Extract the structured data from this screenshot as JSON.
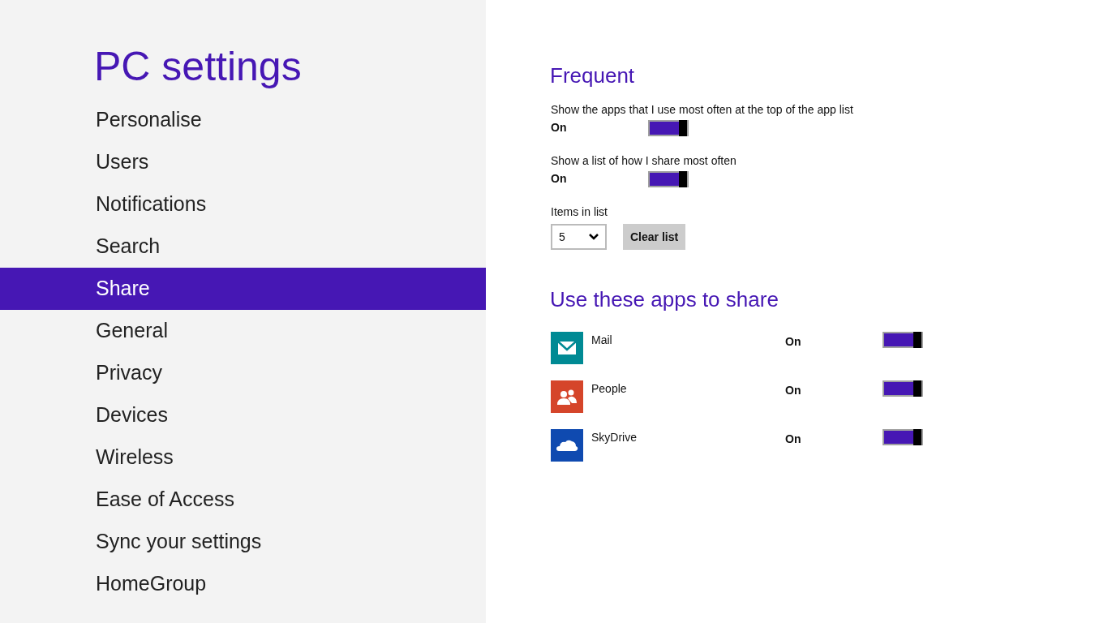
{
  "sidebar": {
    "title": "PC settings",
    "items": [
      {
        "label": "Personalise",
        "selected": false
      },
      {
        "label": "Users",
        "selected": false
      },
      {
        "label": "Notifications",
        "selected": false
      },
      {
        "label": "Search",
        "selected": false
      },
      {
        "label": "Share",
        "selected": true
      },
      {
        "label": "General",
        "selected": false
      },
      {
        "label": "Privacy",
        "selected": false
      },
      {
        "label": "Devices",
        "selected": false
      },
      {
        "label": "Wireless",
        "selected": false
      },
      {
        "label": "Ease of Access",
        "selected": false
      },
      {
        "label": "Sync your settings",
        "selected": false
      },
      {
        "label": "HomeGroup",
        "selected": false
      }
    ]
  },
  "frequent": {
    "heading": "Frequent",
    "settings": [
      {
        "label": "Show the apps that I use most often at the top of the app list",
        "state": "On",
        "on": true
      },
      {
        "label": "Show a list of how I share most often",
        "state": "On",
        "on": true
      }
    ],
    "items_label": "Items in list",
    "items_value": "5",
    "clear_button": "Clear list"
  },
  "apps": {
    "heading": "Use these apps to share",
    "items": [
      {
        "name": "Mail",
        "kind": "mail",
        "color": "#008a94",
        "state": "On",
        "on": true
      },
      {
        "name": "People",
        "kind": "people",
        "color": "#d5452a",
        "state": "On",
        "on": true
      },
      {
        "name": "SkyDrive",
        "kind": "cloud",
        "color": "#0f4ab0",
        "state": "On",
        "on": true
      }
    ]
  }
}
